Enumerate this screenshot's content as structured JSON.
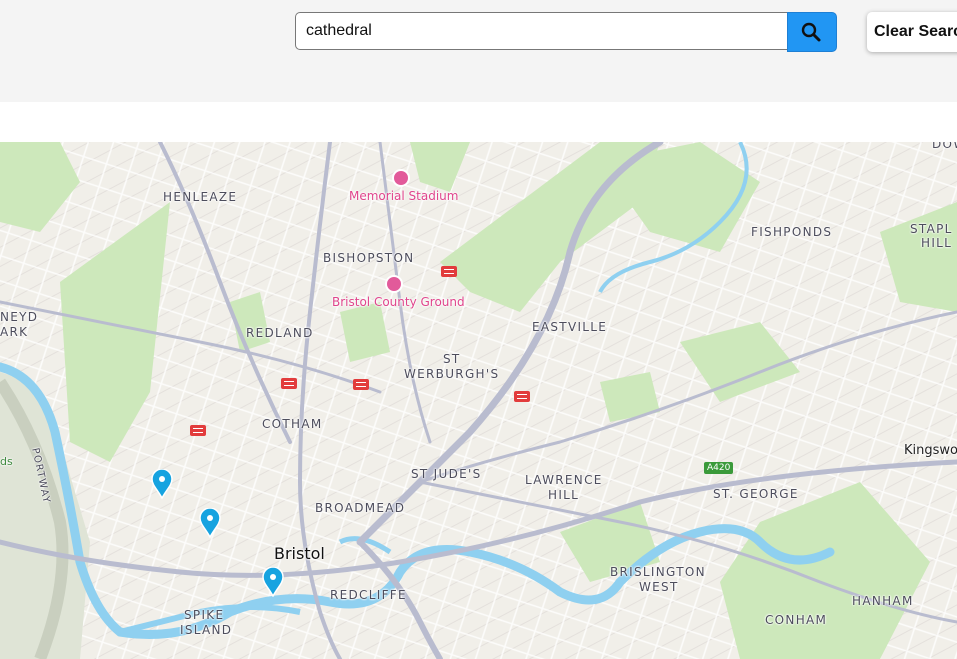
{
  "search": {
    "value": "cathedral",
    "button_icon": "search-icon",
    "clear_label": "Clear Search"
  },
  "map": {
    "areas": [
      {
        "id": "henleaze",
        "text": "HENLEAZE"
      },
      {
        "id": "bishopston",
        "text": "BISHOPSTON"
      },
      {
        "id": "fishponds",
        "text": "FISHPONDS"
      },
      {
        "id": "stapleton-1",
        "text": "STAPL"
      },
      {
        "id": "stapleton-2",
        "text": "HILL"
      },
      {
        "id": "redland",
        "text": "REDLAND"
      },
      {
        "id": "eastville",
        "text": "EASTVILLE"
      },
      {
        "id": "st-werburghs-1",
        "text": "ST"
      },
      {
        "id": "st-werburghs-2",
        "text": "WERBURGH'S"
      },
      {
        "id": "cotham",
        "text": "COTHAM"
      },
      {
        "id": "st-judes",
        "text": "ST JUDE'S"
      },
      {
        "id": "lawrence-hill-1",
        "text": "LAWRENCE"
      },
      {
        "id": "lawrence-hill-2",
        "text": "HILL"
      },
      {
        "id": "st-george",
        "text": "ST. GEORGE"
      },
      {
        "id": "broadmead",
        "text": "BROADMEAD"
      },
      {
        "id": "brislington-1",
        "text": "BRISLINGTON"
      },
      {
        "id": "brislington-2",
        "text": "WEST"
      },
      {
        "id": "redcliffe",
        "text": "REDCLIFFE"
      },
      {
        "id": "hanham",
        "text": "HANHAM"
      },
      {
        "id": "spike-island-1",
        "text": "SPIKE"
      },
      {
        "id": "spike-island-2",
        "text": "ISLAND"
      },
      {
        "id": "conham",
        "text": "CONHAM"
      },
      {
        "id": "sneyd-park-1",
        "text": "NEYD"
      },
      {
        "id": "sneyd-park-2",
        "text": "ARK"
      },
      {
        "id": "portway",
        "text": "PORTWAY"
      },
      {
        "id": "downend",
        "text": "DOW"
      }
    ],
    "pois": [
      {
        "id": "memorial-stadium",
        "text": "Memorial Stadium"
      },
      {
        "id": "county-ground",
        "text": "Bristol County Ground"
      }
    ],
    "city": "Bristol",
    "town": "Kingswo",
    "green_label": "ds",
    "road_shield": "A420",
    "colors": {
      "park": "#c8e6b4",
      "water": "#8fd0f0",
      "marker": "#16a3e0",
      "poi": "#e0458c",
      "rail": "#e23c3c"
    }
  }
}
